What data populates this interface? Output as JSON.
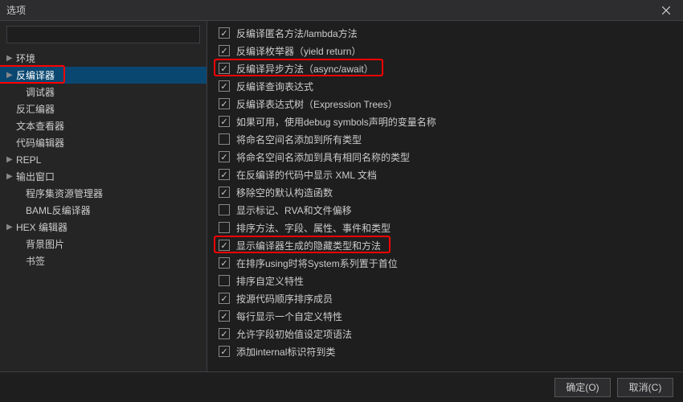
{
  "window": {
    "title": "选项"
  },
  "sidebar": {
    "search_placeholder": "",
    "items": [
      {
        "label": "环境",
        "expandable": true
      },
      {
        "label": "反编译器",
        "expandable": true,
        "selected": true,
        "highlight": true
      },
      {
        "label": "调试器",
        "expandable": false,
        "indent": true
      },
      {
        "label": "反汇编器",
        "expandable": false
      },
      {
        "label": "文本查看器",
        "expandable": false
      },
      {
        "label": "代码编辑器",
        "expandable": false
      },
      {
        "label": "REPL",
        "expandable": true
      },
      {
        "label": "输出窗口",
        "expandable": true
      },
      {
        "label": "程序集资源管理器",
        "expandable": false,
        "indent": true
      },
      {
        "label": "BAML反编译器",
        "expandable": false,
        "indent": true
      },
      {
        "label": "HEX 编辑器",
        "expandable": true
      },
      {
        "label": "背景图片",
        "expandable": false,
        "indent": true
      },
      {
        "label": "书签",
        "expandable": false,
        "indent": true
      }
    ]
  },
  "options": [
    {
      "label": "反编译匿名方法/lambda方法",
      "checked": true
    },
    {
      "label": "反编译枚举器（yield return）",
      "checked": true
    },
    {
      "label": "反编译异步方法（async/await）",
      "checked": true,
      "highlight": true
    },
    {
      "label": "反编译查询表达式",
      "checked": true
    },
    {
      "label": "反编译表达式树（Expression Trees）",
      "checked": true
    },
    {
      "label": "如果可用，使用debug symbols声明的变量名称",
      "checked": true
    },
    {
      "label": "将命名空间名添加到所有类型",
      "checked": false
    },
    {
      "label": "将命名空间名添加到具有相同名称的类型",
      "checked": true
    },
    {
      "label": "在反编译的代码中显示 XML 文档",
      "checked": true
    },
    {
      "label": "移除空的默认构造函数",
      "checked": true
    },
    {
      "label": "显示标记、RVA和文件偏移",
      "checked": false
    },
    {
      "label": "排序方法、字段、属性、事件和类型",
      "checked": false
    },
    {
      "label": "显示编译器生成的隐藏类型和方法",
      "checked": true,
      "highlight": true
    },
    {
      "label": "在排序using时将System系列置于首位",
      "checked": true
    },
    {
      "label": "排序自定义特性",
      "checked": false
    },
    {
      "label": "按源代码顺序排序成员",
      "checked": true
    },
    {
      "label": "每行显示一个自定义特性",
      "checked": true
    },
    {
      "label": "允许字段初始值设定项语法",
      "checked": true
    },
    {
      "label": "添加internal标识符到类",
      "checked": true
    }
  ],
  "footer": {
    "ok": "确定(O)",
    "cancel": "取消(C)"
  }
}
